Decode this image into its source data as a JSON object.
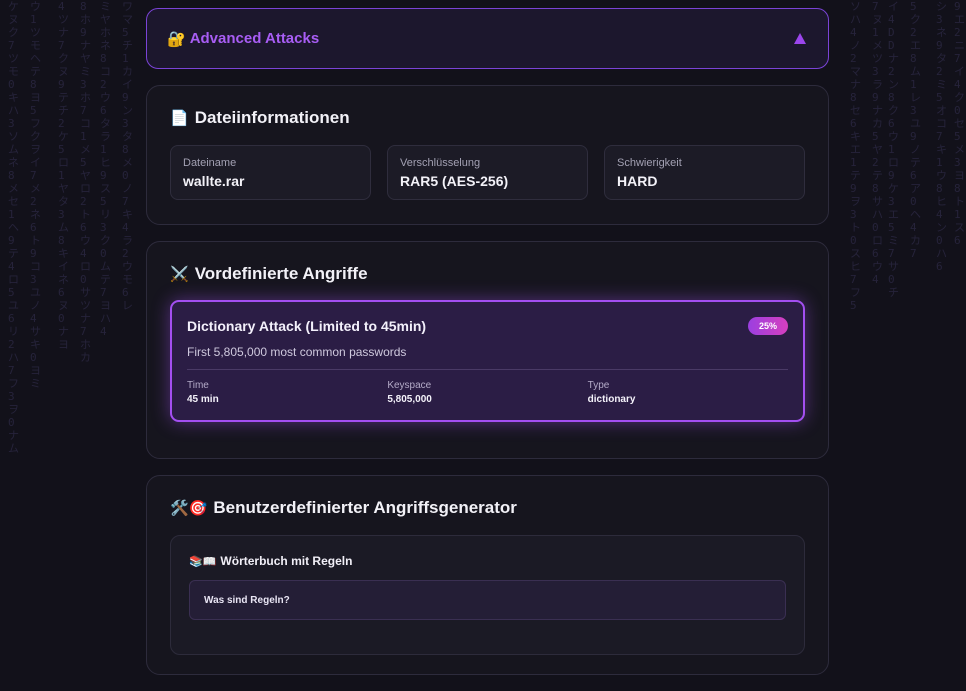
{
  "advanced": {
    "icon": "🔐",
    "title": "Advanced Attacks",
    "toggle_icon": "triangle-up-icon"
  },
  "file_info": {
    "icon": "📄",
    "title": "Dateiinformationen",
    "fields": [
      {
        "label": "Dateiname",
        "value": "wallte.rar"
      },
      {
        "label": "Verschlüsselung",
        "value": "RAR5 (AES-256)"
      },
      {
        "label": "Schwierigkeit",
        "value": "HARD"
      }
    ]
  },
  "predefined": {
    "icon": "⚔️",
    "title": "Vordefinierte Angriffe",
    "attack": {
      "name": "Dictionary Attack (Limited to 45min)",
      "badge": "25%",
      "description": "First 5,805,000 most common passwords",
      "stats": [
        {
          "label": "Time",
          "value": "45 min"
        },
        {
          "label": "Keyspace",
          "value": "5,805,000"
        },
        {
          "label": "Type",
          "value": "dictionary"
        }
      ]
    }
  },
  "custom": {
    "icon": "🛠️🎯",
    "title": "Benutzerdefinierter Angriffsgenerator",
    "dictionary": {
      "icon": "📚📖",
      "title": "Wörterbuch mit Regeln",
      "rules_heading": "Was sind Regeln?"
    }
  },
  "colors": {
    "accent": "#a85df4",
    "badge_gradient_start": "#9b3fe0",
    "badge_gradient_end": "#d63fbf",
    "background": "#12111a"
  }
}
